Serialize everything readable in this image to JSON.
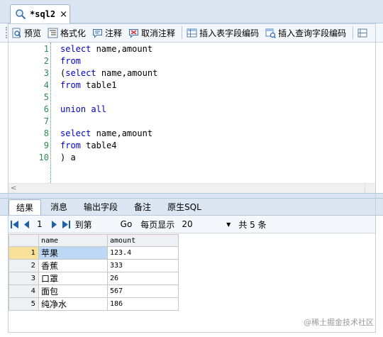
{
  "editor_tab": {
    "title": "*sql2",
    "close": "×"
  },
  "toolbar": {
    "buttons": [
      {
        "label": "预览"
      },
      {
        "label": "格式化"
      },
      {
        "label": "注释"
      },
      {
        "label": "取消注释"
      },
      {
        "label": "插入表字段编码"
      },
      {
        "label": "插入查询字段编码"
      }
    ]
  },
  "editor": {
    "lines": [
      {
        "n": "1",
        "kw": "select",
        "rest": " name,amount",
        "pre": ""
      },
      {
        "n": "2",
        "kw": "from",
        "rest": "",
        "pre": ""
      },
      {
        "n": "3",
        "kw": "select",
        "rest": " name,amount",
        "pre": "("
      },
      {
        "n": "4",
        "kw": "from",
        "rest": " table1",
        "pre": ""
      },
      {
        "n": "5",
        "kw": "",
        "rest": "",
        "pre": ""
      },
      {
        "n": "6",
        "kw": "union all",
        "rest": "",
        "pre": ""
      },
      {
        "n": "7",
        "kw": "",
        "rest": "",
        "pre": ""
      },
      {
        "n": "8",
        "kw": "select",
        "rest": " name,amount",
        "pre": ""
      },
      {
        "n": "9",
        "kw": "from",
        "rest": " table4",
        "pre": ""
      },
      {
        "n": "10",
        "kw": "",
        "rest": ") a",
        "pre": ""
      }
    ]
  },
  "result_tabs": [
    {
      "label": "结果",
      "active": true
    },
    {
      "label": "消息",
      "active": false
    },
    {
      "label": "输出字段",
      "active": false
    },
    {
      "label": "备注",
      "active": false
    },
    {
      "label": "原生SQL",
      "active": false
    }
  ],
  "pager": {
    "page": "1",
    "goto_label": "到第",
    "go": "Go",
    "per_page_label": "每页显示",
    "page_size": "20",
    "total": "共 5 条"
  },
  "grid": {
    "columns": [
      "name",
      "amount"
    ],
    "rows": [
      {
        "num": "1",
        "name": "苹果",
        "amount": "123.4"
      },
      {
        "num": "2",
        "name": "香蕉",
        "amount": "333"
      },
      {
        "num": "3",
        "name": "口罩",
        "amount": "26"
      },
      {
        "num": "4",
        "name": "面包",
        "amount": "567"
      },
      {
        "num": "5",
        "name": "纯净水",
        "amount": "186"
      }
    ]
  },
  "watermark": "@稀土掘金技术社区",
  "colors": {
    "keyword": "#0000cc",
    "line_number": "#2e8b57",
    "chrome": "#dce6f2",
    "selected_cell": "#bcd8f4",
    "current_row": "#f7e19a"
  }
}
